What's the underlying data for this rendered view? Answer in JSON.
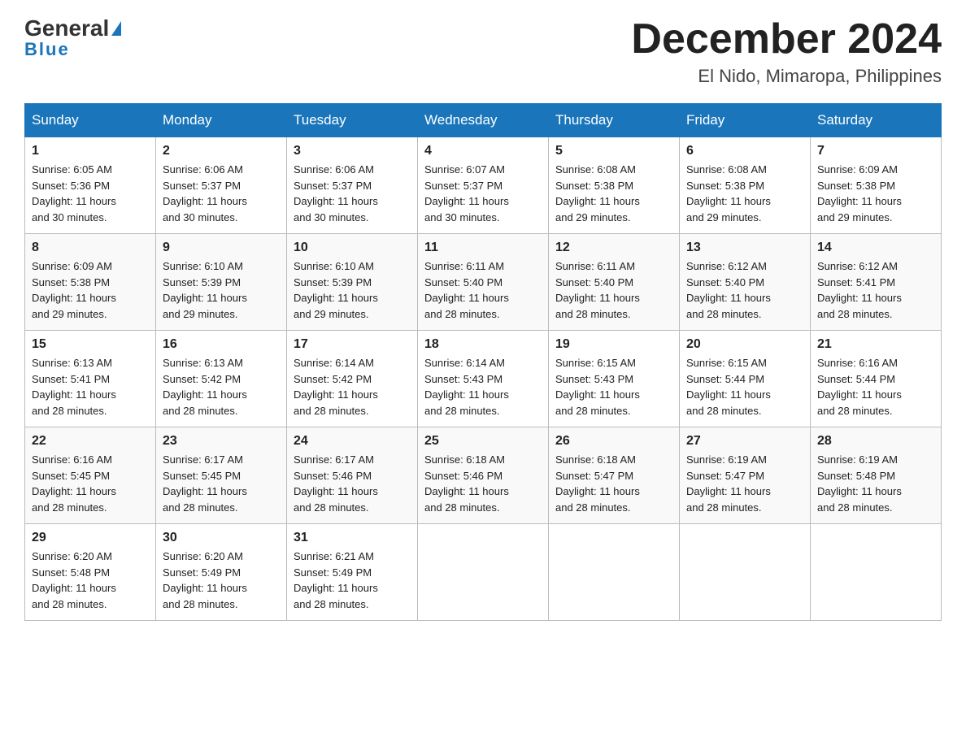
{
  "header": {
    "logo_general": "General",
    "logo_blue": "Blue",
    "month_title": "December 2024",
    "location": "El Nido, Mimaropa, Philippines"
  },
  "weekdays": [
    "Sunday",
    "Monday",
    "Tuesday",
    "Wednesday",
    "Thursday",
    "Friday",
    "Saturday"
  ],
  "weeks": [
    [
      {
        "day": "1",
        "sunrise": "6:05 AM",
        "sunset": "5:36 PM",
        "daylight": "11 hours and 30 minutes."
      },
      {
        "day": "2",
        "sunrise": "6:06 AM",
        "sunset": "5:37 PM",
        "daylight": "11 hours and 30 minutes."
      },
      {
        "day": "3",
        "sunrise": "6:06 AM",
        "sunset": "5:37 PM",
        "daylight": "11 hours and 30 minutes."
      },
      {
        "day": "4",
        "sunrise": "6:07 AM",
        "sunset": "5:37 PM",
        "daylight": "11 hours and 30 minutes."
      },
      {
        "day": "5",
        "sunrise": "6:08 AM",
        "sunset": "5:38 PM",
        "daylight": "11 hours and 29 minutes."
      },
      {
        "day": "6",
        "sunrise": "6:08 AM",
        "sunset": "5:38 PM",
        "daylight": "11 hours and 29 minutes."
      },
      {
        "day": "7",
        "sunrise": "6:09 AM",
        "sunset": "5:38 PM",
        "daylight": "11 hours and 29 minutes."
      }
    ],
    [
      {
        "day": "8",
        "sunrise": "6:09 AM",
        "sunset": "5:38 PM",
        "daylight": "11 hours and 29 minutes."
      },
      {
        "day": "9",
        "sunrise": "6:10 AM",
        "sunset": "5:39 PM",
        "daylight": "11 hours and 29 minutes."
      },
      {
        "day": "10",
        "sunrise": "6:10 AM",
        "sunset": "5:39 PM",
        "daylight": "11 hours and 29 minutes."
      },
      {
        "day": "11",
        "sunrise": "6:11 AM",
        "sunset": "5:40 PM",
        "daylight": "11 hours and 28 minutes."
      },
      {
        "day": "12",
        "sunrise": "6:11 AM",
        "sunset": "5:40 PM",
        "daylight": "11 hours and 28 minutes."
      },
      {
        "day": "13",
        "sunrise": "6:12 AM",
        "sunset": "5:40 PM",
        "daylight": "11 hours and 28 minutes."
      },
      {
        "day": "14",
        "sunrise": "6:12 AM",
        "sunset": "5:41 PM",
        "daylight": "11 hours and 28 minutes."
      }
    ],
    [
      {
        "day": "15",
        "sunrise": "6:13 AM",
        "sunset": "5:41 PM",
        "daylight": "11 hours and 28 minutes."
      },
      {
        "day": "16",
        "sunrise": "6:13 AM",
        "sunset": "5:42 PM",
        "daylight": "11 hours and 28 minutes."
      },
      {
        "day": "17",
        "sunrise": "6:14 AM",
        "sunset": "5:42 PM",
        "daylight": "11 hours and 28 minutes."
      },
      {
        "day": "18",
        "sunrise": "6:14 AM",
        "sunset": "5:43 PM",
        "daylight": "11 hours and 28 minutes."
      },
      {
        "day": "19",
        "sunrise": "6:15 AM",
        "sunset": "5:43 PM",
        "daylight": "11 hours and 28 minutes."
      },
      {
        "day": "20",
        "sunrise": "6:15 AM",
        "sunset": "5:44 PM",
        "daylight": "11 hours and 28 minutes."
      },
      {
        "day": "21",
        "sunrise": "6:16 AM",
        "sunset": "5:44 PM",
        "daylight": "11 hours and 28 minutes."
      }
    ],
    [
      {
        "day": "22",
        "sunrise": "6:16 AM",
        "sunset": "5:45 PM",
        "daylight": "11 hours and 28 minutes."
      },
      {
        "day": "23",
        "sunrise": "6:17 AM",
        "sunset": "5:45 PM",
        "daylight": "11 hours and 28 minutes."
      },
      {
        "day": "24",
        "sunrise": "6:17 AM",
        "sunset": "5:46 PM",
        "daylight": "11 hours and 28 minutes."
      },
      {
        "day": "25",
        "sunrise": "6:18 AM",
        "sunset": "5:46 PM",
        "daylight": "11 hours and 28 minutes."
      },
      {
        "day": "26",
        "sunrise": "6:18 AM",
        "sunset": "5:47 PM",
        "daylight": "11 hours and 28 minutes."
      },
      {
        "day": "27",
        "sunrise": "6:19 AM",
        "sunset": "5:47 PM",
        "daylight": "11 hours and 28 minutes."
      },
      {
        "day": "28",
        "sunrise": "6:19 AM",
        "sunset": "5:48 PM",
        "daylight": "11 hours and 28 minutes."
      }
    ],
    [
      {
        "day": "29",
        "sunrise": "6:20 AM",
        "sunset": "5:48 PM",
        "daylight": "11 hours and 28 minutes."
      },
      {
        "day": "30",
        "sunrise": "6:20 AM",
        "sunset": "5:49 PM",
        "daylight": "11 hours and 28 minutes."
      },
      {
        "day": "31",
        "sunrise": "6:21 AM",
        "sunset": "5:49 PM",
        "daylight": "11 hours and 28 minutes."
      },
      null,
      null,
      null,
      null
    ]
  ],
  "labels": {
    "sunrise": "Sunrise:",
    "sunset": "Sunset:",
    "daylight": "Daylight:"
  }
}
